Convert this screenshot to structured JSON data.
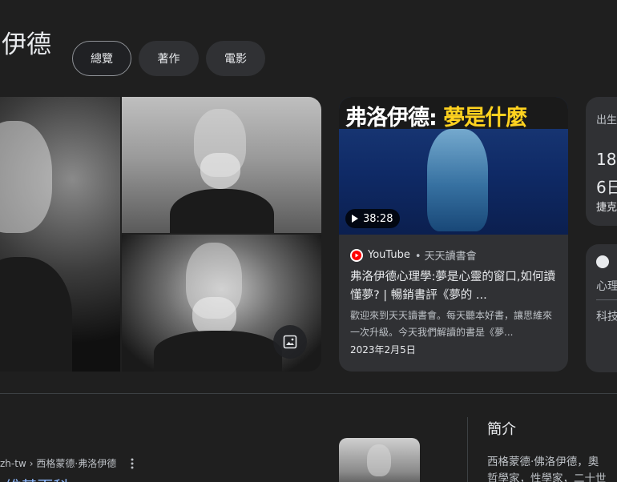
{
  "header": {
    "title": "伊德"
  },
  "chips": [
    {
      "label": "總覽"
    },
    {
      "label": "著作"
    },
    {
      "label": "電影"
    }
  ],
  "video": {
    "thumb_title_white": "弗洛伊德: ",
    "thumb_title_yellow": "夢是什麼",
    "duration": "38:28",
    "source": "YouTube",
    "channel": "• 天天讀書會",
    "title": "弗洛伊德心理學:夢是心靈的窗口,如何讀懂夢? | 暢銷書評《夢的 ...",
    "description": "歡迎來到天天讀書會。每天聽本好書，讓思維來一次升級。今天我們解讀的書是《夢...",
    "date": "2023年2月5日"
  },
  "info_card": {
    "label": "出生",
    "line1": "18",
    "line2": "6日",
    "line3": "捷克"
  },
  "info_card2": {
    "line1": "心理",
    "line2": "科技"
  },
  "result": {
    "crumb_site": "zh-tw",
    "crumb_path": "› 西格蒙德·弗洛伊德",
    "title": "·维基百科"
  },
  "intro": {
    "heading": "簡介",
    "line1": "西格蒙德·佛洛伊德，奧",
    "line2": "哲學家，性學家，二十世"
  },
  "colors": {
    "accent_yellow": "#ffd21f",
    "link": "#8ab4f8",
    "youtube_red": "#ff0000"
  }
}
